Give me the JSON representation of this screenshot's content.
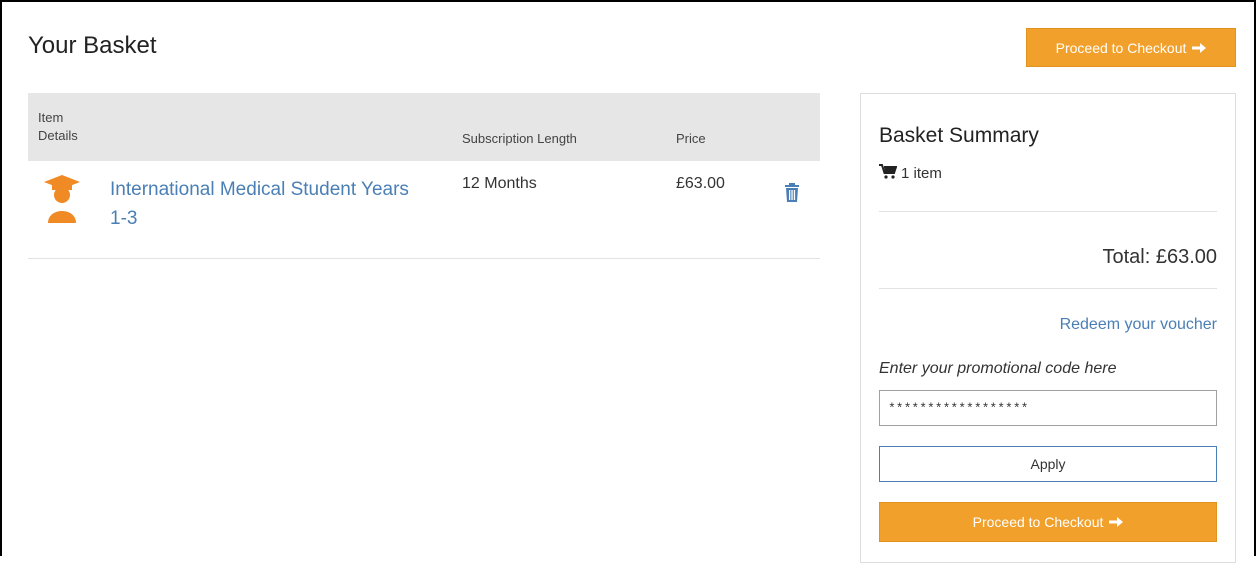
{
  "header": {
    "title": "Your Basket",
    "checkout_label": "Proceed to Checkout"
  },
  "table": {
    "columns": {
      "details": "Item\nDetails",
      "subscription": "Subscription Length",
      "price": "Price"
    },
    "rows": [
      {
        "name": "International Medical Student Years 1-3",
        "subscription_length": "12 Months",
        "price": "£63.00",
        "icon": "graduate-student-icon",
        "remove_icon": "trash-icon"
      }
    ]
  },
  "summary": {
    "title": "Basket Summary",
    "item_count": "1 item",
    "total_label": "Total:",
    "total_value": "£63.00",
    "voucher_link": "Redeem your voucher",
    "promo_label": "Enter your promotional code here",
    "promo_value": "******************",
    "apply_label": "Apply",
    "checkout_label": "Proceed to Checkout"
  },
  "colors": {
    "accent": "#f1a02b",
    "link": "#4a7fb5",
    "header_bg": "#e6e6e6",
    "icon_orange": "#f08a24"
  }
}
